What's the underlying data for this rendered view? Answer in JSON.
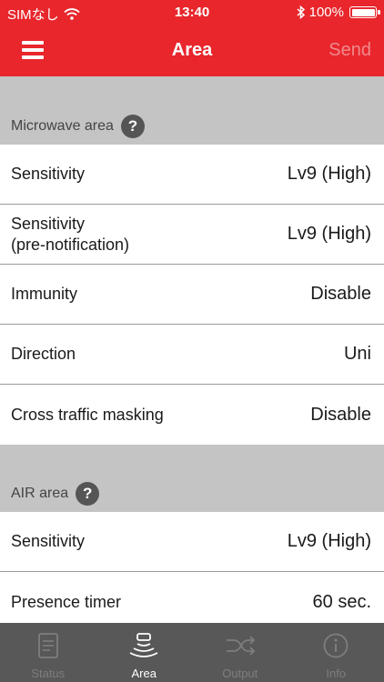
{
  "status_bar": {
    "carrier": "SIMなし",
    "time": "13:40",
    "battery": "100%"
  },
  "nav": {
    "title": "Area",
    "send_label": "Send"
  },
  "microwave_section": {
    "title": "Microwave area",
    "rows": [
      {
        "label": "Sensitivity",
        "value": "Lv9 (High)"
      },
      {
        "label": "Sensitivity",
        "label2": "(pre-notification)",
        "value": "Lv9 (High)"
      },
      {
        "label": "Immunity",
        "value": "Disable"
      },
      {
        "label": "Direction",
        "value": "Uni"
      },
      {
        "label": "Cross traffic masking",
        "value": "Disable"
      }
    ]
  },
  "air_section": {
    "title": "AIR area",
    "rows": [
      {
        "label": "Sensitivity",
        "value": "Lv9 (High)"
      },
      {
        "label": "Presence timer",
        "value": "60 sec."
      }
    ]
  },
  "tabs": [
    {
      "label": "Status",
      "icon": "document-icon",
      "active": false
    },
    {
      "label": "Area",
      "icon": "sensor-waves-icon",
      "active": true
    },
    {
      "label": "Output",
      "icon": "shuffle-icon",
      "active": false
    },
    {
      "label": "Info",
      "icon": "info-icon",
      "active": false
    }
  ],
  "colors": {
    "accent": "#e8262c",
    "tab_bar": "#585858",
    "section_bg": "#c4c4c4"
  }
}
